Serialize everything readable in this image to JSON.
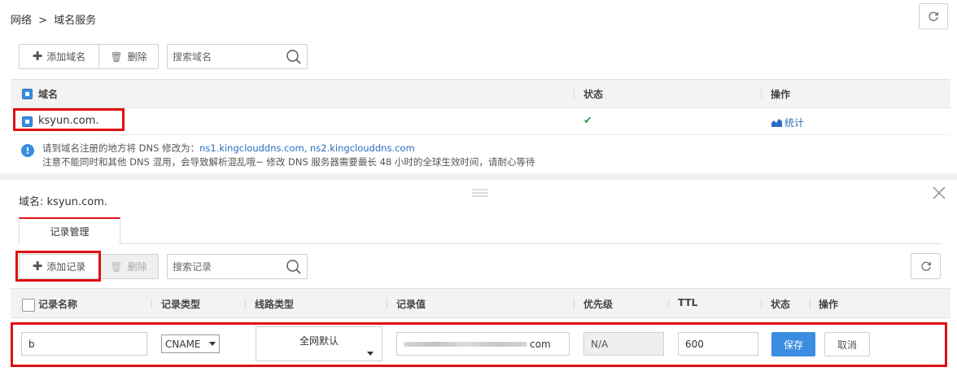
{
  "breadcrumb": {
    "network": "网络",
    "sep": ">",
    "current": "域名服务"
  },
  "toolbar": {
    "add_domain": "添加域名",
    "delete": "删除",
    "search_placeholder": "搜索域名"
  },
  "domain_table": {
    "headers": {
      "name": "域名",
      "status": "状态",
      "action": "操作"
    },
    "rows": [
      {
        "name": "ksyun.com.",
        "status_icon": "check-icon",
        "action": "统计"
      }
    ]
  },
  "notice": {
    "line1_prefix": "请到域名注册的地方将 DNS 修改为：",
    "line1_ns": "ns1.kingclouddns.com, ns2.kingclouddns.com",
    "line2": "注意不能同时和其他 DNS 混用，会导致解析混乱哦~ 修改 DNS 服务器需要最长 48 小时的全球生效时间，请耐心等待"
  },
  "detail": {
    "domain_label": "域名:",
    "domain_value": "ksyun.com.",
    "tab": "记录管理",
    "add_record": "添加记录",
    "delete": "删除",
    "search_placeholder": "搜索记录"
  },
  "record_table": {
    "headers": {
      "name": "记录名称",
      "type": "记录类型",
      "line": "线路类型",
      "value": "记录值",
      "priority": "优先级",
      "ttl": "TTL",
      "status": "状态",
      "action": "操作"
    },
    "edit_row": {
      "name": "b",
      "type": "CNAME",
      "line": "全网默认",
      "value_suffix": "com",
      "priority": "N/A",
      "ttl": "600",
      "save": "保存",
      "cancel": "取消"
    }
  },
  "colors": {
    "accent": "#3a8de0",
    "link": "#2a6dc0",
    "highlight": "#e01010",
    "success": "#2c9e4a"
  }
}
